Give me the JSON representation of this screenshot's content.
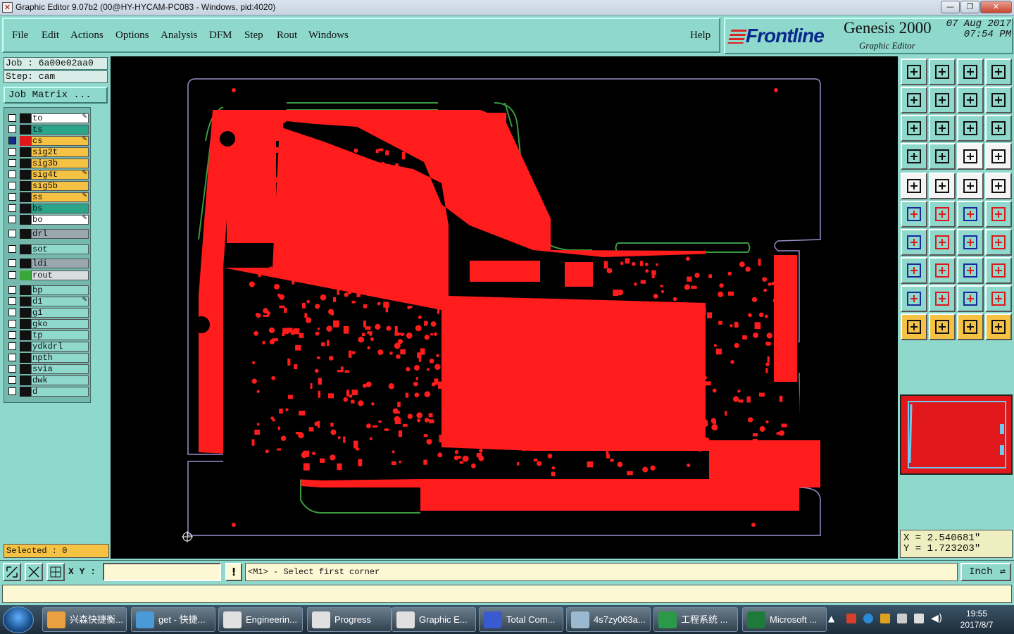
{
  "window": {
    "title": "Graphic Editor 9.07b2 (00@HY-HYCAM-PC083 - Windows, pid:4020)",
    "minimize": "—",
    "maximize": "❐",
    "close": "✕"
  },
  "menu": {
    "items": [
      "File",
      "Edit",
      "Actions",
      "Options",
      "Analysis",
      "DFM",
      "Step",
      "Rout",
      "Windows"
    ],
    "help": "Help"
  },
  "brand": {
    "logo": "Frontline",
    "product": "Genesis 2000",
    "subtitle": "Graphic Editor",
    "date": "07 Aug 2017",
    "time": "07:54 PM"
  },
  "job": {
    "job_label": "Job : 6a00e02aa0",
    "step_label": "Step: cam",
    "job_matrix": "Job Matrix ..."
  },
  "layers": [
    {
      "name": "to",
      "color": "#ffffff",
      "swatch": "#111111",
      "checked": false,
      "editable": true
    },
    {
      "name": "ts",
      "color": "#2aa58a",
      "swatch": "#111111",
      "checked": false,
      "editable": false
    },
    {
      "name": "cs",
      "color": "#f6c244",
      "swatch": "#e0181c",
      "checked": true,
      "editable": true
    },
    {
      "name": "sig2t",
      "color": "#f6c244",
      "swatch": "#111111",
      "checked": false,
      "editable": false
    },
    {
      "name": "sig3b",
      "color": "#f6c244",
      "swatch": "#111111",
      "checked": false,
      "editable": false
    },
    {
      "name": "sig4t",
      "color": "#f6c244",
      "swatch": "#111111",
      "checked": false,
      "editable": true
    },
    {
      "name": "sig5b",
      "color": "#f6c244",
      "swatch": "#111111",
      "checked": false,
      "editable": false
    },
    {
      "name": "ss",
      "color": "#f6c244",
      "swatch": "#111111",
      "checked": false,
      "editable": true
    },
    {
      "name": "bs",
      "color": "#2aa58a",
      "swatch": "#111111",
      "checked": false,
      "editable": false
    },
    {
      "name": "bo",
      "color": "#ffffff",
      "swatch": "#111111",
      "checked": false,
      "editable": true
    },
    {
      "name": "drl",
      "color": "#9aa8b0",
      "swatch": "#111111",
      "checked": false,
      "editable": false
    },
    {
      "name": "sot",
      "color": "#8ed8cc",
      "swatch": "#111111",
      "checked": false,
      "editable": false
    },
    {
      "name": "ldi",
      "color": "#9aa8b0",
      "swatch": "#111111",
      "checked": false,
      "editable": false
    },
    {
      "name": "rout",
      "color": "#d8dcde",
      "swatch": "#3aa838",
      "checked": false,
      "editable": false
    },
    {
      "name": "bp",
      "color": "#8ed8cc",
      "swatch": "#111111",
      "checked": false,
      "editable": false
    },
    {
      "name": "d1",
      "color": "#8ed8cc",
      "swatch": "#111111",
      "checked": false,
      "editable": true
    },
    {
      "name": "g1",
      "color": "#8ed8cc",
      "swatch": "#111111",
      "checked": false,
      "editable": false
    },
    {
      "name": "gko",
      "color": "#8ed8cc",
      "swatch": "#111111",
      "checked": false,
      "editable": false
    },
    {
      "name": "tp",
      "color": "#8ed8cc",
      "swatch": "#111111",
      "checked": false,
      "editable": false
    },
    {
      "name": "ydkdrl",
      "color": "#8ed8cc",
      "swatch": "#111111",
      "checked": false,
      "editable": false
    },
    {
      "name": "npth",
      "color": "#8ed8cc",
      "swatch": "#111111",
      "checked": false,
      "editable": false
    },
    {
      "name": "svia",
      "color": "#8ed8cc",
      "swatch": "#111111",
      "checked": false,
      "editable": false
    },
    {
      "name": "dwk",
      "color": "#8ed8cc",
      "swatch": "#111111",
      "checked": false,
      "editable": false
    },
    {
      "name": "d",
      "color": "#8ed8cc",
      "swatch": "#111111",
      "checked": false,
      "editable": false
    }
  ],
  "selected": "Selected : 0",
  "coords": {
    "x": "X = 2.540681\"",
    "y": "Y = 1.723203\""
  },
  "bottom": {
    "xy_label": "X Y :",
    "xy_value": "",
    "warn": "!",
    "prompt": "<M1> - Select first corner",
    "unit": "Inch"
  },
  "taskbar": {
    "items": [
      {
        "label": "兴森快捷衡...",
        "color": "#e8a040"
      },
      {
        "label": "get - 快捷...",
        "color": "#4a9ad8"
      },
      {
        "label": "Engineerin...",
        "color": "#e0e0e0"
      },
      {
        "label": "Progress",
        "color": "#e0e0e0"
      },
      {
        "label": "Graphic E...",
        "color": "#e0e0e0"
      },
      {
        "label": "Total Com...",
        "color": "#3a5ad0"
      },
      {
        "label": "4s7zy063a...",
        "color": "#9ab8d0"
      },
      {
        "label": "工程系统 ...",
        "color": "#2a9a4a"
      },
      {
        "label": "Microsoft ...",
        "color": "#1e7a3a"
      }
    ],
    "time": "19:55",
    "date": "2017/8/7"
  },
  "colors": {
    "copper": "#ff1c1c",
    "outline": "#9c8cc8",
    "rout": "#3a9a40",
    "panel": "#8ed8cc"
  }
}
